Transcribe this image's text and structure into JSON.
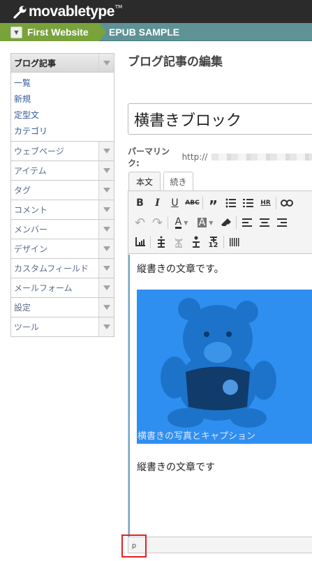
{
  "app": {
    "logo_text": "movabletype",
    "logo_tm": "TM"
  },
  "breadcrumb": {
    "site": "First Website",
    "blog": "EPUB SAMPLE"
  },
  "sidebar": {
    "active": "ブログ記事",
    "submenu": [
      "一覧",
      "新規",
      "定型文",
      "カテゴリ"
    ],
    "items": [
      "ウェブページ",
      "アイテム",
      "タグ",
      "コメント",
      "メンバー",
      "デザイン",
      "カスタムフィールド",
      "メールフォーム",
      "設定",
      "ツール"
    ]
  },
  "main": {
    "page_title": "ブログ記事の編集",
    "entry_title": "横書きブロック",
    "permalink_label": "パーマリンク:",
    "permalink_url": "http://"
  },
  "tabs": {
    "body": "本文",
    "more": "続き"
  },
  "toolbar": {
    "bold": "B",
    "italic": "I",
    "underline": "U",
    "strike": "ABC",
    "hr": "HR",
    "text_color": "A",
    "bg_color": "A",
    "vertical_12": "12"
  },
  "content": {
    "paragraph1": "縦書きの文章です。",
    "caption": "横書きの写真とキャプション",
    "paragraph2": "縦書きの文章です"
  },
  "statusbar": {
    "path": "p"
  },
  "colors": {
    "topbar": "#2b2b2b",
    "site_crumb": "#79a23b",
    "blog_crumb": "#5e9294",
    "image_tint": "#2e8ff0",
    "highlight": "#e12222"
  }
}
